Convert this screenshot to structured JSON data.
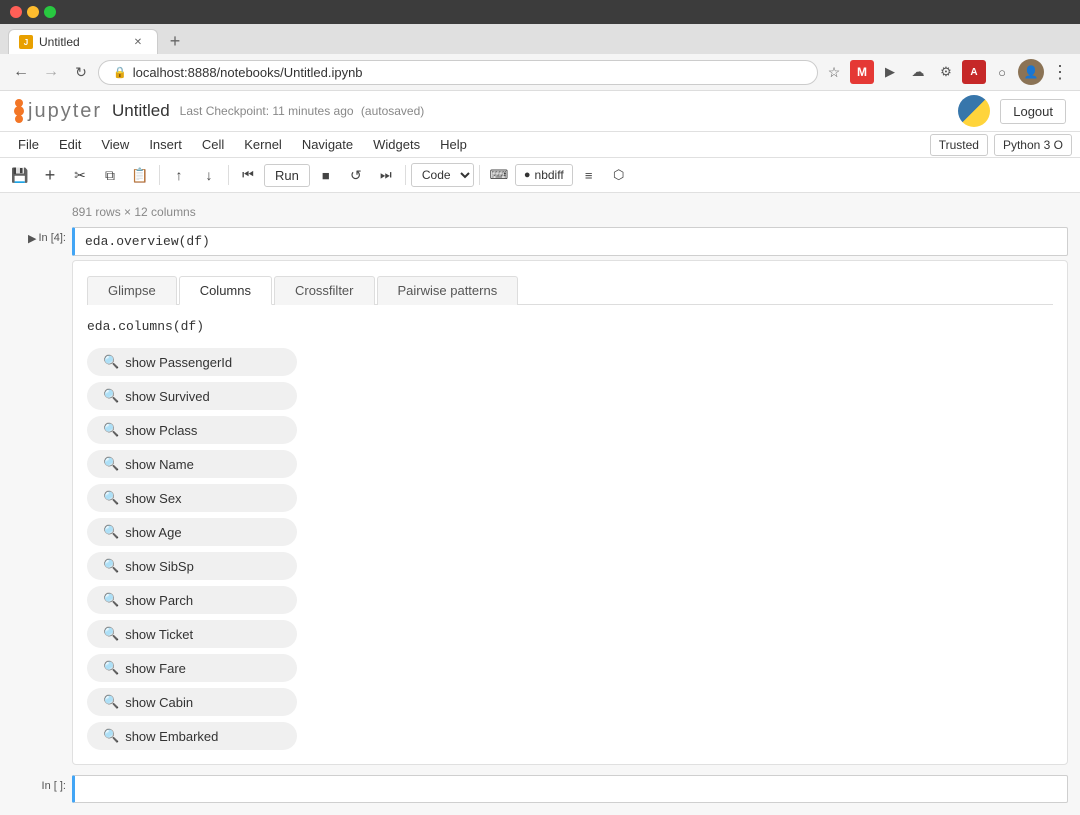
{
  "browser": {
    "tab_title": "Untitled",
    "tab_favicon": "🔴",
    "address": "localhost:8888/notebooks/Untitled.ipynb",
    "new_tab_label": "+"
  },
  "jupyter": {
    "logo_text": "jupyter",
    "notebook_title": "Untitled",
    "checkpoint_text": "Last Checkpoint: 11 minutes ago",
    "autosaved_text": "(autosaved)",
    "logout_label": "Logout"
  },
  "menu": {
    "items": [
      "File",
      "Edit",
      "View",
      "Insert",
      "Cell",
      "Kernel",
      "Navigate",
      "Widgets",
      "Help"
    ],
    "trusted_label": "Trusted",
    "python_label": "Python 3 O"
  },
  "toolbar": {
    "save_title": "Save",
    "add_cell_title": "Add cell",
    "cut_title": "Cut",
    "copy_title": "Copy",
    "paste_title": "Paste",
    "move_up_title": "Move up",
    "move_down_title": "Move down",
    "fast_forward_title": "Skip to start",
    "run_label": "Run",
    "stop_label": "Stop",
    "restart_label": "Restart",
    "next_label": "Next",
    "cell_type": "Code",
    "keyboard_title": "Keyboard shortcuts",
    "nbdiff_label": "nbdiff",
    "cell_toolbar_title": "Toggle cell toolbar"
  },
  "notebook": {
    "rows_info": "891 rows × 12 columns",
    "cell_in_4": "In [4]:",
    "cell_code": "eda.overview(df)",
    "cell_in_empty": "In [ ]:"
  },
  "output": {
    "tabs": [
      "Glimpse",
      "Columns",
      "Crossfilter",
      "Pairwise patterns"
    ],
    "active_tab": "Columns",
    "code_line": "eda.columns(df)",
    "columns": [
      {
        "label": "show PassengerId"
      },
      {
        "label": "show Survived"
      },
      {
        "label": "show Pclass"
      },
      {
        "label": "show Name"
      },
      {
        "label": "show Sex"
      },
      {
        "label": "show Age"
      },
      {
        "label": "show SibSp"
      },
      {
        "label": "show Parch"
      },
      {
        "label": "show Ticket"
      },
      {
        "label": "show Fare"
      },
      {
        "label": "show Cabin"
      },
      {
        "label": "show Embarked"
      }
    ]
  },
  "icons": {
    "search": "🔍",
    "star": "☆",
    "shield": "🛡",
    "extensions": "⊞",
    "profile": "👤",
    "more": "⋮",
    "back": "←",
    "forward": "→",
    "refresh": "↻",
    "lock": "🔒"
  }
}
